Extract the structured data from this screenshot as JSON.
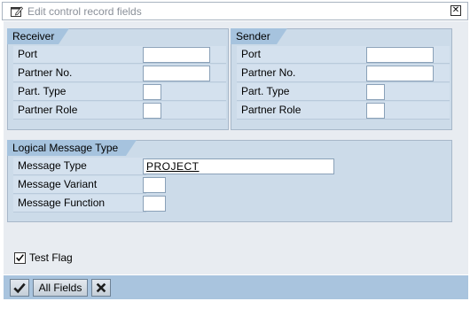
{
  "window": {
    "title": "Edit control record fields",
    "close_glyph": "✕"
  },
  "receiver": {
    "title": "Receiver",
    "rows": [
      {
        "label": "Port",
        "value": ""
      },
      {
        "label": "Partner No.",
        "value": ""
      },
      {
        "label": "Part. Type",
        "value": ""
      },
      {
        "label": "Partner Role",
        "value": ""
      }
    ]
  },
  "sender": {
    "title": "Sender",
    "rows": [
      {
        "label": "Port",
        "value": ""
      },
      {
        "label": "Partner No.",
        "value": ""
      },
      {
        "label": "Part. Type",
        "value": ""
      },
      {
        "label": "Partner Role",
        "value": ""
      }
    ]
  },
  "logical": {
    "title": "Logical Message Type",
    "rows": [
      {
        "label": "Message Type",
        "value": "PROJECT"
      },
      {
        "label": "Message Variant",
        "value": ""
      },
      {
        "label": "Message Function",
        "value": ""
      }
    ]
  },
  "test_flag": {
    "label": "Test Flag",
    "checked": true
  },
  "footer": {
    "confirm_icon": "check-icon",
    "all_fields_label": "All Fields",
    "cancel_icon": "cancel-icon"
  }
}
